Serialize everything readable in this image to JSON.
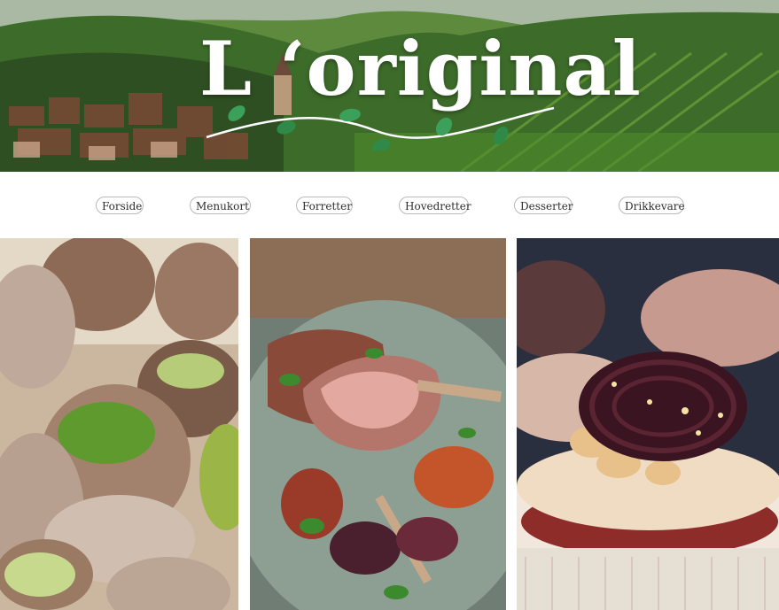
{
  "brand": {
    "logo_text": "L ‘original"
  },
  "nav": {
    "items": [
      {
        "label": "Forside"
      },
      {
        "label": "Menukort"
      },
      {
        "label": "Forretter"
      },
      {
        "label": "Hovedretter"
      },
      {
        "label": "Desserter"
      },
      {
        "label": "Drikkevare"
      }
    ]
  },
  "images": {
    "hero": "vineyard-village-landscape",
    "panel_1": "escargots-with-herb-butter",
    "panel_2": "rack-of-lamb-with-roasted-beets",
    "panel_3": "dessert-with-chocolate-lattice"
  },
  "colors": {
    "logo": "#ffffff",
    "leaf": "#3aa05a",
    "nav_border": "#b9b9b9"
  }
}
